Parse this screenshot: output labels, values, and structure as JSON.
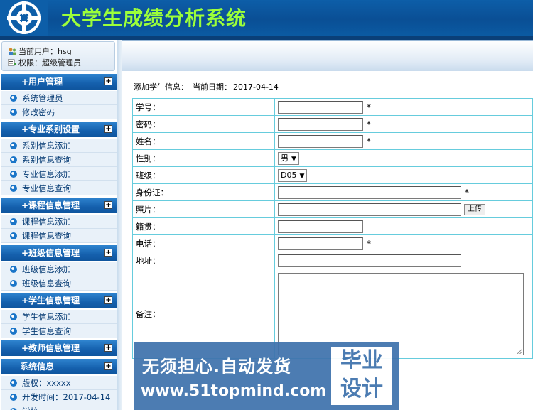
{
  "app": {
    "title": "大学生成绩分析系统"
  },
  "user": {
    "current_label": "当前用户：",
    "current_value": "hsg",
    "role_label": "权限：",
    "role_value": "超级管理员"
  },
  "sidebar": {
    "sections": [
      {
        "title": "+用户管理",
        "items": [
          "系统管理员",
          "修改密码"
        ]
      },
      {
        "title": "+专业系别设置",
        "items": [
          "系别信息添加",
          "系别信息查询",
          "专业信息添加",
          "专业信息查询"
        ]
      },
      {
        "title": "+课程信息管理",
        "items": [
          "课程信息添加",
          "课程信息查询"
        ]
      },
      {
        "title": "+班级信息管理",
        "items": [
          "班级信息添加",
          "班级信息查询"
        ]
      },
      {
        "title": "+学生信息管理",
        "items": [
          "学生信息添加",
          "学生信息查询"
        ]
      },
      {
        "title": "+教师信息管理",
        "items": []
      },
      {
        "title": "系统信息",
        "items": [
          "版权：xxxxx",
          "开发时间：2017-04-14",
          "学校"
        ]
      }
    ],
    "toggle_glyph": "+"
  },
  "page": {
    "heading": "添加学生信息：",
    "date_label": "当前日期：",
    "date_value": "2017-04-14"
  },
  "form": {
    "student_no": "学号：",
    "password": "密码：",
    "name": "姓名：",
    "gender": "性别：",
    "gender_value": "男",
    "class": "班级：",
    "class_value": "D05",
    "id_card": "身份证：",
    "photo": "照片：",
    "upload_button": "上传",
    "native_place": "籍贯：",
    "phone": "电话：",
    "address": "地址：",
    "remark": "备注：",
    "required_mark": "*",
    "select_arrow": "▼"
  },
  "watermark": {
    "line1": "无须担心.自动发货",
    "line2": "www.51topmind.com",
    "box_top": "毕业",
    "box_bottom": "设计"
  },
  "colors": {
    "header": "#0b57a0",
    "title": "#9cff3a",
    "nav_head": "#1560ad",
    "nav_item_bg": "#e9f1f9",
    "table_border": "#66ccdd",
    "watermark": "#3f73ad"
  }
}
